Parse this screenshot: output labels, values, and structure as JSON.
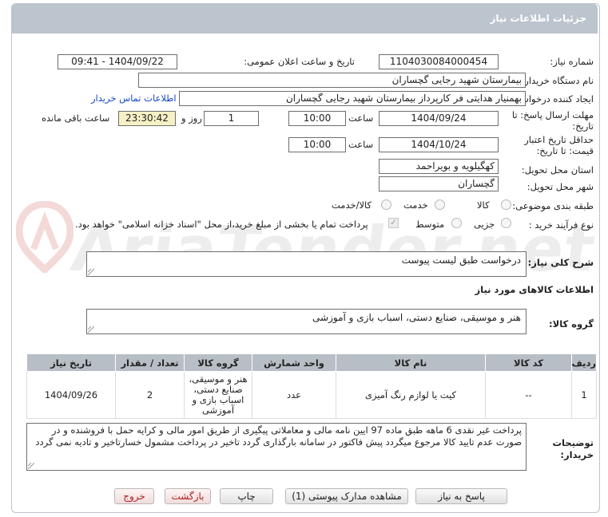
{
  "header": {
    "title": "جزئیات اطلاعات نیاز"
  },
  "fields": {
    "need_number_label": "شماره نیاز:",
    "need_number": "1104030084000454",
    "announce_label": "تاریخ و ساعت اعلان عمومی:",
    "announce_value": "1404/09/22 - 09:41",
    "buyer_org_label": "نام دستگاه خریدار:",
    "buyer_org": "بیمارستان شهید رجایی گچساران",
    "creator_label": "ایجاد کننده درخواست:",
    "creator": "بهمنیار هدایتی فر کارپرداز بیمارستان شهید رجایی گچساران",
    "contact_link": "اطلاعات تماس خریدار",
    "reply_deadline_label_1": "مهلت ارسال پاسخ: تا",
    "reply_deadline_label_2": "تاریخ:",
    "reply_date": "1404/09/24",
    "time_label": "ساعت",
    "reply_time": "10:00",
    "days_value": "1",
    "days_label": "روز و",
    "remaining_time": "23:30:42",
    "remaining_label": "ساعت باقی مانده",
    "price_validity_label_1": "حداقل تاریخ اعتبار",
    "price_validity_label_2": "قیمت: تا تاریخ:",
    "price_date": "1404/10/24",
    "price_time": "10:00",
    "province_label": "استان محل تحویل:",
    "province": "کهگیلویه و بویراحمد",
    "city_label": "شهر محل تحویل:",
    "city": "گچساران",
    "category_label": "طبقه بندی موضوعی:",
    "category_options": [
      "کالا",
      "خدمت",
      "کالا/خدمت"
    ],
    "process_label": "نوع فرآیند خرید :",
    "process_options": [
      "جزیی",
      "متوسط"
    ],
    "payment_note": "پرداخت تمام یا بخشی از مبلغ خرید،از محل \"اسناد خزانه اسلامی\" خواهد بود."
  },
  "summary": {
    "label": "شرح کلی نیاز:",
    "text": "درخواست طبق لیست پیوست"
  },
  "goods_section": {
    "title": "اطلاعات کالاهای مورد نیاز",
    "group_label": "گروه کالا:",
    "group_text": "هنر و موسیقی، صنایع دستی، اسباب بازی و آموزشی"
  },
  "table": {
    "headers": [
      "ردیف",
      "کد کالا",
      "نام کالا",
      "واحد شمارش",
      "گروه کالا",
      "تعداد / مقدار",
      "تاریخ نیاز"
    ],
    "rows": [
      [
        "1",
        "--",
        "کیت یا لوازم رنگ آمیزی",
        "عدد",
        "هنر و موسیقی، صنایع دستی، اسباب بازی و آموزشی",
        "2",
        "1404/09/26"
      ]
    ]
  },
  "buyer_notes": {
    "label_1": "توضیحات",
    "label_2": "خریدار:",
    "text": "پرداخت غیر نقدی 6 ماهه  طبق ماده 97 ایین نامه مالی و معاملاتی پیگیری از طریق امور مالی  و کرایه حمل با فروشنده و در صورت عدم تایید کالا مرجوع میگردد پیش فاکتور در سامانه بارگذاری گردد  تاخیر  در پرداخت مشمول خسارتاخیر و تادیه نمی گردد"
  },
  "buttons": {
    "reply": "پاسخ به نیاز",
    "attachments": "مشاهده مدارک پیوستی (1)",
    "print": "چاپ",
    "back": "بازگشت",
    "exit": "خروج"
  },
  "watermark": "AriaTender.net",
  "colors": {
    "header_bg": "#bcc4ce",
    "table_header_bg": "#b8bec6",
    "timer_bg": "#f6f0c5",
    "link": "#1747c9"
  }
}
